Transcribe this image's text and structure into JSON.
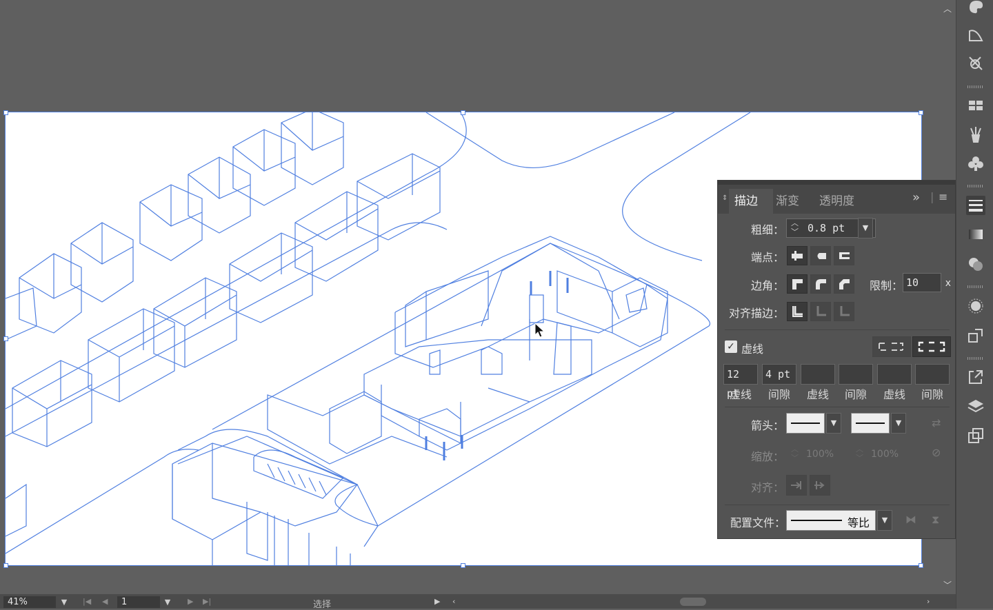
{
  "canvas": {
    "zoom": "41%",
    "page": "1",
    "mode": "选择"
  },
  "stroke_panel": {
    "tabs": [
      "描边",
      "渐变",
      "透明度"
    ],
    "weight_label": "粗细：",
    "weight_value": "0.8 pt",
    "cap_label": "端点：",
    "corner_label": "边角：",
    "limit_label": "限制：",
    "limit_value": "10",
    "limit_unit": "x",
    "align_label": "对齐描边：",
    "dashed_label": "虚线",
    "dashed_checked": true,
    "dash_fields": [
      {
        "value": "12 pt",
        "label": "虚线"
      },
      {
        "value": "4 pt",
        "label": "间隙"
      },
      {
        "value": "",
        "label": "虚线"
      },
      {
        "value": "",
        "label": "间隙"
      },
      {
        "value": "",
        "label": "虚线"
      },
      {
        "value": "",
        "label": "间隙"
      }
    ],
    "arrow_label": "箭头：",
    "scale_label": "缩放：",
    "scale_start": "100%",
    "scale_end": "100%",
    "arrow_align_label": "对齐：",
    "profile_label": "配置文件：",
    "profile_value": "等比"
  },
  "colors": {
    "accent": "#4f7fe0",
    "panel_bg": "#535353",
    "canvas_bg": "#5f5f5f"
  }
}
